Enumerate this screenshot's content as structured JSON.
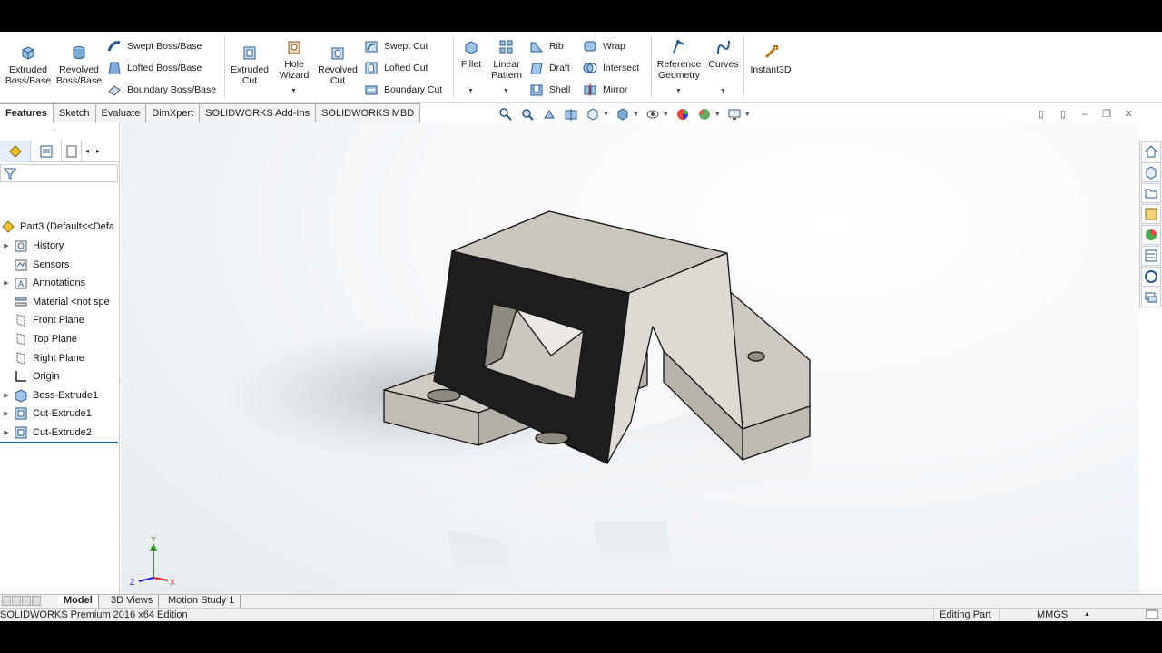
{
  "ribbon": {
    "extruded_boss": "Extruded\nBoss/Base",
    "revolved_boss": "Revolved\nBoss/Base",
    "swept_boss": "Swept Boss/Base",
    "lofted_boss": "Lofted Boss/Base",
    "boundary_boss": "Boundary Boss/Base",
    "extruded_cut": "Extruded\nCut",
    "hole_wizard": "Hole\nWizard",
    "revolved_cut": "Revolved\nCut",
    "swept_cut": "Swept Cut",
    "lofted_cut": "Lofted Cut",
    "boundary_cut": "Boundary Cut",
    "fillet": "Fillet",
    "linear_pattern": "Linear\nPattern",
    "rib": "Rib",
    "draft": "Draft",
    "shell": "Shell",
    "wrap": "Wrap",
    "intersect": "Intersect",
    "mirror": "Mirror",
    "reference_geometry": "Reference\nGeometry",
    "curves": "Curves",
    "instant3d": "Instant3D"
  },
  "tabs": [
    "Features",
    "Sketch",
    "Evaluate",
    "DimXpert",
    "SOLIDWORKS Add-Ins",
    "SOLIDWORKS MBD"
  ],
  "tree": {
    "root": "Part3  (Default<<Defa",
    "items": [
      {
        "label": "History",
        "icon": "history-icon",
        "expand": true
      },
      {
        "label": "Sensors",
        "icon": "sensors-icon",
        "expand": false
      },
      {
        "label": "Annotations",
        "icon": "annotations-icon",
        "expand": true
      },
      {
        "label": "Material <not spe",
        "icon": "material-icon",
        "expand": false
      },
      {
        "label": "Front Plane",
        "icon": "plane-icon",
        "expand": false
      },
      {
        "label": "Top Plane",
        "icon": "plane-icon",
        "expand": false
      },
      {
        "label": "Right Plane",
        "icon": "plane-icon",
        "expand": false
      },
      {
        "label": "Origin",
        "icon": "origin-icon",
        "expand": false
      },
      {
        "label": "Boss-Extrude1",
        "icon": "boss-extrude-icon",
        "expand": true
      },
      {
        "label": "Cut-Extrude1",
        "icon": "cut-extrude-icon",
        "expand": true
      },
      {
        "label": "Cut-Extrude2",
        "icon": "cut-extrude-icon",
        "expand": true
      }
    ]
  },
  "bottom_tabs": [
    "Model",
    "3D Views",
    "Motion Study 1"
  ],
  "status": {
    "edition": "SOLIDWORKS Premium 2016 x64 Edition",
    "mode": "Editing Part",
    "units": "MMGS"
  },
  "triad": {
    "x": "X",
    "y": "Y",
    "z": "Z"
  },
  "colors": {
    "accent": "#1f5fa8",
    "model_face": "#cbc6bf",
    "model_dark": "#1e1e1e"
  }
}
